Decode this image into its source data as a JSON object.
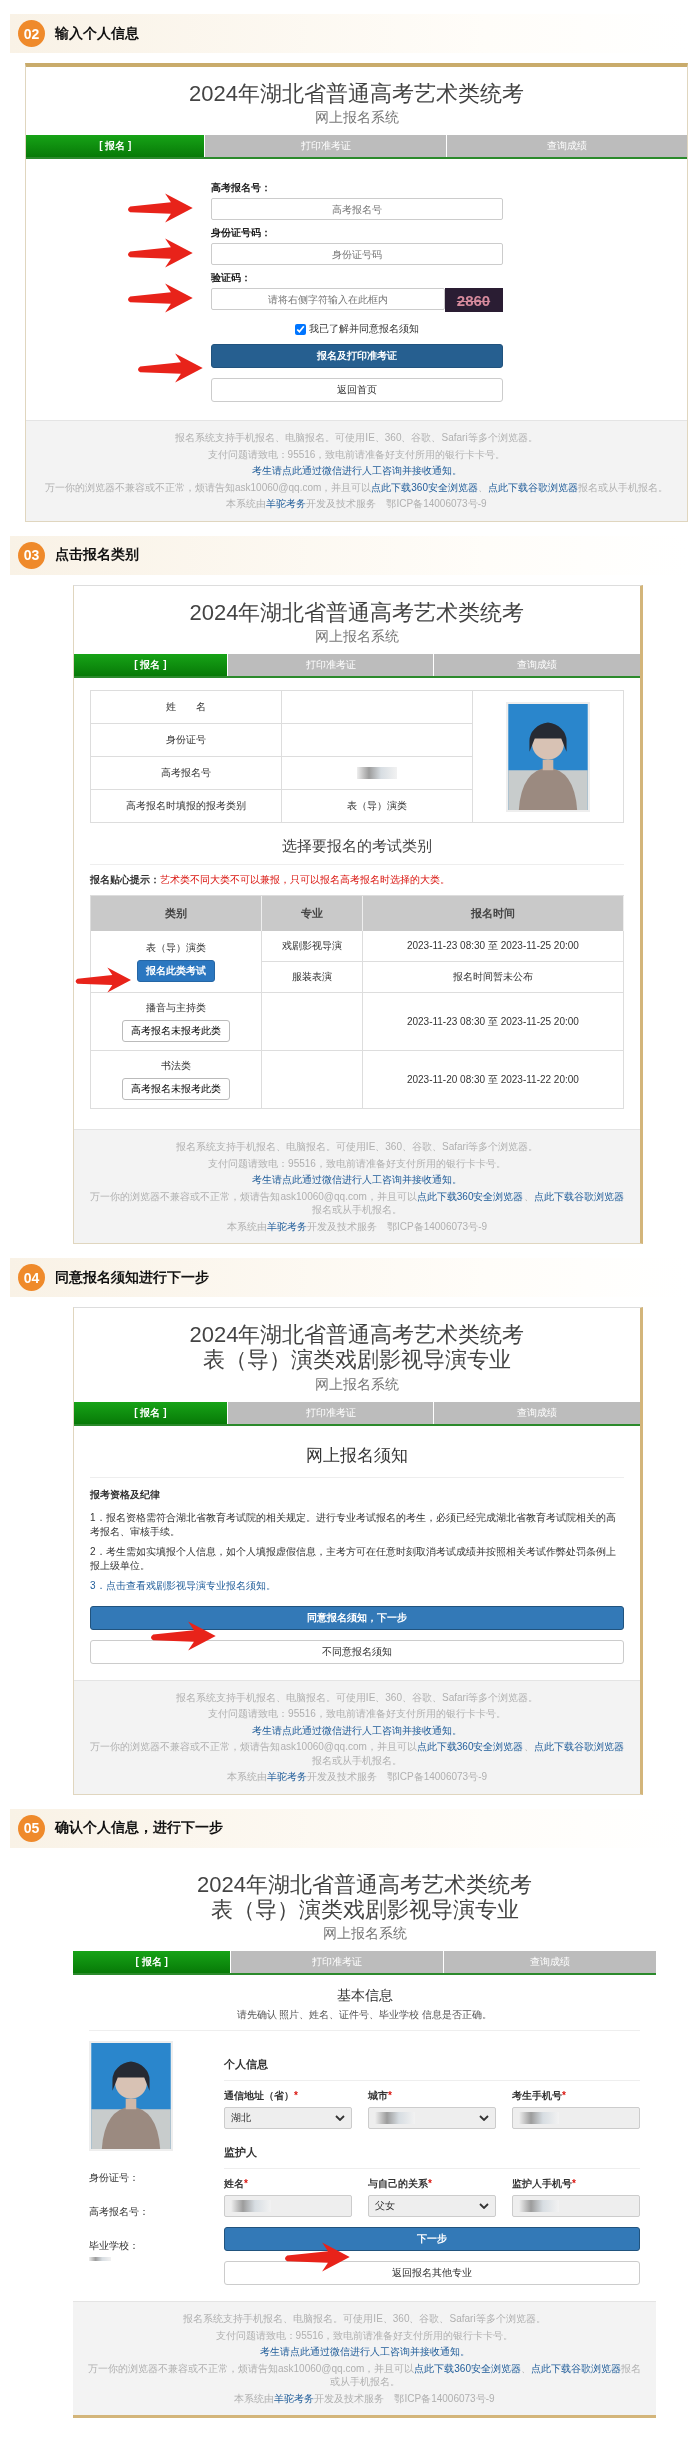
{
  "steps": [
    {
      "number": "02",
      "title": "输入个人信息",
      "screen": {
        "kind": "login",
        "title_lines": [
          "2024年湖北省普通高考艺术类统考"
        ],
        "subtitle": "网上报名系统",
        "tabs": [
          {
            "label": "[ 报名 ]",
            "selected": true
          },
          {
            "label": "打印准考证",
            "selected": false
          },
          {
            "label": "查询成绩",
            "selected": false
          }
        ],
        "fields": [
          {
            "label": "高考报名号：",
            "placeholder": "高考报名号",
            "pointed": true
          },
          {
            "label": "身份证号码：",
            "placeholder": "身份证号码",
            "pointed": true
          },
          {
            "label": "验证码：",
            "placeholder": "请将右侧字符输入在此框内",
            "captcha": "2860",
            "pointed": true
          }
        ],
        "agreement": {
          "label": "我已了解并同意报名须知",
          "checked": true
        },
        "buttons": [
          {
            "label": "报名及打印准考证",
            "primary": true,
            "pointed": true
          },
          {
            "label": "返回首页",
            "primary": false,
            "pointed": false
          }
        ],
        "footer": [
          [
            {
              "text": "报名系统支持手机报名、电脑报名。可使用IE、360、谷歌、Safari等多个浏览器。",
              "link": false
            }
          ],
          [
            {
              "text": "支付问题请致电：95516，致电前请准备好支付所用的银行卡卡号。",
              "link": false
            }
          ],
          [
            {
              "text": "考生请点此通过微信进行人工咨询并接收通知。",
              "link": true
            }
          ],
          [
            {
              "text": "万一你的浏览器不兼容或不正常，烦请告知ask10060@qq.com，并且可以",
              "link": false
            },
            {
              "text": "点此下载360安全浏览器",
              "link": true
            },
            {
              "text": "、",
              "link": false
            },
            {
              "text": "点此下载谷歌浏览器",
              "link": true
            },
            {
              "text": "报名或从手机报名。",
              "link": false
            }
          ],
          [
            {
              "text": "本系统由",
              "link": false
            },
            {
              "text": "羊驼考务",
              "link": true
            },
            {
              "text": "开发及技术服务　鄂ICP备14006073号-9",
              "link": false
            }
          ]
        ]
      }
    },
    {
      "number": "03",
      "title": "点击报名类别",
      "screen": {
        "kind": "category",
        "title_lines": [
          "2024年湖北省普通高考艺术类统考"
        ],
        "subtitle": "网上报名系统",
        "tabs": [
          {
            "label": "[ 报名 ]",
            "selected": true
          },
          {
            "label": "打印准考证",
            "selected": false
          },
          {
            "label": "查询成绩",
            "selected": false
          }
        ],
        "info_rows": [
          {
            "label": "姓　　名",
            "blurred": false
          },
          {
            "label": "身份证号",
            "blurred": false
          },
          {
            "label": "高考报名号",
            "blurred": true
          },
          {
            "label": "高考报名时填报的报考类别",
            "value": "表（导）演类",
            "blurred": false
          }
        ],
        "photo": {
          "kind": "picture"
        },
        "heading": "选择要报名的考试类别",
        "tip": {
          "label": "报名贴心提示：",
          "text": "艺术类不同大类不可以兼报，只可以报名高考报名时选择的大类。"
        },
        "columns": [
          "类别",
          "专业",
          "报名时间"
        ],
        "rows": [
          {
            "category": "表（导）演类",
            "button": {
              "label": "报名此类考试",
              "primary": true,
              "pointed": true
            },
            "majors": [
              {
                "name": "戏剧影视导演",
                "time": "2023-11-23 08:30 至 2023-11-25 20:00"
              },
              {
                "name": "服装表演",
                "time": "报名时间暂未公布"
              }
            ]
          },
          {
            "category": "播音与主持类",
            "button": {
              "label": "高考报名未报考此类",
              "primary": false,
              "pointed": false
            },
            "majors": [
              {
                "time": "2023-11-23 08:30 至 2023-11-25 20:00"
              }
            ]
          },
          {
            "category": "书法类",
            "button": {
              "label": "高考报名未报考此类",
              "primary": false,
              "pointed": false
            },
            "majors": [
              {
                "time": "2023-11-20 08:30 至 2023-11-22 20:00"
              }
            ]
          }
        ],
        "footer": [
          [
            {
              "text": "报名系统支持手机报名、电脑报名。可使用IE、360、谷歌、Safari等多个浏览器。",
              "link": false
            }
          ],
          [
            {
              "text": "支付问题请致电：95516，致电前请准备好支付所用的银行卡卡号。",
              "link": false
            }
          ],
          [
            {
              "text": "考生请点此通过微信进行人工咨询并接收通知。",
              "link": true
            }
          ],
          [
            {
              "text": "万一你的浏览器不兼容或不正常，烦请告知ask10060@qq.com，并且可以",
              "link": false
            },
            {
              "text": "点此下载360安全浏览器",
              "link": true
            },
            {
              "text": "、",
              "link": false
            },
            {
              "text": "点此下载谷歌浏览器",
              "link": true
            },
            {
              "text": "报名或从手机报名。",
              "link": false
            }
          ],
          [
            {
              "text": "本系统由",
              "link": false
            },
            {
              "text": "羊驼考务",
              "link": true
            },
            {
              "text": "开发及技术服务　鄂ICP备14006073号-9",
              "link": false
            }
          ]
        ]
      }
    },
    {
      "number": "04",
      "title": "同意报名须知进行下一步",
      "screen": {
        "kind": "notice",
        "title_lines": [
          "2024年湖北省普通高考艺术类统考",
          "表（导）演类戏剧影视导演专业"
        ],
        "subtitle": "网上报名系统",
        "tabs": [
          {
            "label": "[ 报名 ]",
            "selected": true
          },
          {
            "label": "打印准考证",
            "selected": false
          },
          {
            "label": "查询成绩",
            "selected": false
          }
        ],
        "heading": "网上报名须知",
        "section_title": "报考资格及纪律",
        "items": [
          {
            "text": "1．报名资格需符合湖北省教育考试院的相关规定。进行专业考试报名的考生，必须已经完成湖北省教育考试院相关的高考报名、审核手续。",
            "link": false
          },
          {
            "text": "2．考生需如实填报个人信息，如个人填报虚假信息，主考方可在任意时刻取消考试成绩并按照相关考试作弊处罚条例上报上级单位。",
            "link": false
          },
          {
            "text": "3．点击查看戏剧影视导演专业报名须知。",
            "link": true
          }
        ],
        "buttons": [
          {
            "label": "同意报名须知，下一步",
            "primary": true,
            "pointed": true
          },
          {
            "label": "不同意报名须知",
            "primary": false,
            "pointed": false
          }
        ],
        "footer": [
          [
            {
              "text": "报名系统支持手机报名、电脑报名。可使用IE、360、谷歌、Safari等多个浏览器。",
              "link": false
            }
          ],
          [
            {
              "text": "支付问题请致电：95516，致电前请准备好支付所用的银行卡卡号。",
              "link": false
            }
          ],
          [
            {
              "text": "考生请点此通过微信进行人工咨询并接收通知。",
              "link": true
            }
          ],
          [
            {
              "text": "万一你的浏览器不兼容或不正常，烦请告知ask10060@qq.com，并且可以",
              "link": false
            },
            {
              "text": "点此下载360安全浏览器",
              "link": true
            },
            {
              "text": "、",
              "link": false
            },
            {
              "text": "点此下载谷歌浏览器",
              "link": true
            },
            {
              "text": "报名或从手机报名。",
              "link": false
            }
          ],
          [
            {
              "text": "本系统由",
              "link": false
            },
            {
              "text": "羊驼考务",
              "link": true
            },
            {
              "text": "开发及技术服务　鄂ICP备14006073号-9",
              "link": false
            }
          ]
        ]
      }
    },
    {
      "number": "05",
      "title": "确认个人信息，进行下一步",
      "screen": {
        "kind": "confirm",
        "title_lines": [
          "2024年湖北省普通高考艺术类统考",
          "表（导）演类戏剧影视导演专业"
        ],
        "subtitle": "网上报名系统",
        "tabs": [
          {
            "label": "[ 报名 ]",
            "selected": true
          },
          {
            "label": "打印准考证",
            "selected": false
          },
          {
            "label": "查询成绩",
            "selected": false
          }
        ],
        "heading": "基本信息",
        "hint": "请先确认 照片、姓名、证件号、毕业学校 信息是否正确。",
        "photo": {
          "kind": "picture"
        },
        "side_labels": [
          {
            "label": "身份证号：",
            "blurred": false
          },
          {
            "label": "高考报名号：",
            "blurred": false
          },
          {
            "label": "毕业学校：",
            "blurred": true
          }
        ],
        "sections": [
          {
            "title": "个人信息",
            "fields": [
              {
                "label": "通信地址（省）",
                "required_mark": "*",
                "kind": "select",
                "value": "湖北",
                "blurred": false
              },
              {
                "label": "城市",
                "required_mark": "*",
                "kind": "select",
                "blurred": true
              },
              {
                "label": "考生手机号",
                "required_mark": "*",
                "kind": "input",
                "blurred": true
              }
            ]
          },
          {
            "title": "监护人",
            "fields": [
              {
                "label": "姓名",
                "required_mark": "*",
                "kind": "input",
                "blurred": true
              },
              {
                "label": "与自己的关系",
                "required_mark": "*",
                "kind": "select",
                "value": "父女",
                "blurred": false
              },
              {
                "label": "监护人手机号",
                "required_mark": "*",
                "kind": "input",
                "blurred": true
              }
            ]
          }
        ],
        "buttons": [
          {
            "label": "下一步",
            "primary": true,
            "pointed": true
          },
          {
            "label": "返回报名其他专业",
            "primary": false,
            "pointed": false
          }
        ],
        "footer": [
          [
            {
              "text": "报名系统支持手机报名、电脑报名。可使用IE、360、谷歌、Safari等多个浏览器。",
              "link": false
            }
          ],
          [
            {
              "text": "支付问题请致电：95516，致电前请准备好支付所用的银行卡卡号。",
              "link": false
            }
          ],
          [
            {
              "text": "考生请点此通过微信进行人工咨询并接收通知。",
              "link": true
            }
          ],
          [
            {
              "text": "万一你的浏览器不兼容或不正常，烦请告知ask10060@qq.com，并且可以",
              "link": false
            },
            {
              "text": "点此下载360安全浏览器",
              "link": true
            },
            {
              "text": "、",
              "link": false
            },
            {
              "text": "点此下载谷歌浏览器",
              "link": true
            },
            {
              "text": "报名或从手机报名。",
              "link": false
            }
          ],
          [
            {
              "text": "本系统由",
              "link": false
            },
            {
              "text": "羊驼考务",
              "link": true
            },
            {
              "text": "开发及技术服务　鄂ICP备14006073号-9",
              "link": false
            }
          ]
        ]
      }
    }
  ]
}
